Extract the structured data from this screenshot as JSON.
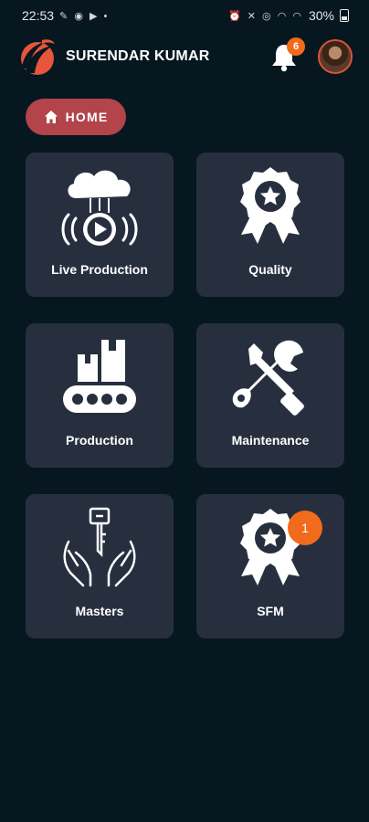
{
  "status_bar": {
    "time": "22:53",
    "left_icons": "✎ ◉ ▶ •",
    "right_icons": "⏰ ✕ ◎ ◠ ◠",
    "battery": "30%"
  },
  "header": {
    "user_name": "SURENDAR KUMAR",
    "notification_count": "6"
  },
  "breadcrumb": {
    "home_label": "HOME"
  },
  "tiles": [
    {
      "label": "Live Production",
      "icon": "cloud-play-icon"
    },
    {
      "label": "Quality",
      "icon": "award-ribbon-icon"
    },
    {
      "label": "Production",
      "icon": "conveyor-belt-icon"
    },
    {
      "label": "Maintenance",
      "icon": "wrench-screwdriver-icon"
    },
    {
      "label": "Masters",
      "icon": "key-hands-icon"
    },
    {
      "label": "SFM",
      "icon": "award-ribbon-icon",
      "badge": "1"
    }
  ],
  "colors": {
    "background": "#061720",
    "tile": "#272f3f",
    "home_chip": "#b3444b",
    "badge": "#f26a1b"
  }
}
